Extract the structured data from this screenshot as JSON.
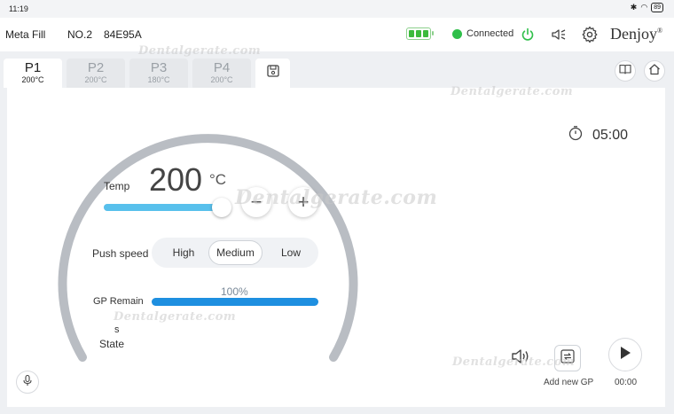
{
  "status_bar": {
    "time": "11:19",
    "battery_level": "89"
  },
  "header": {
    "app_name": "Meta Fill",
    "device_no": "NO.2",
    "device_id": "84E95A",
    "connection_status": "Connected",
    "connection_color": "#2fbf4a",
    "brand": "Denjoy",
    "brand_mark": "®",
    "icons": [
      "battery-icon",
      "power-icon",
      "mute-speaker-icon",
      "settings-gear-icon"
    ]
  },
  "tabs": [
    {
      "name": "P1",
      "temp": "200°C",
      "active": true
    },
    {
      "name": "P2",
      "temp": "200°C",
      "active": false
    },
    {
      "name": "P3",
      "temp": "180°C",
      "active": false
    },
    {
      "name": "P4",
      "temp": "200°C",
      "active": false
    }
  ],
  "tab_actions": {
    "save_icon": "save-icon",
    "manual_icon": "book-icon",
    "home_icon": "home-icon"
  },
  "main": {
    "temp_label": "Temp",
    "temp_value": "200",
    "temp_unit": "°C",
    "temp_slider_fraction": 0.95,
    "minus_label": "−",
    "plus_label": "+",
    "push_speed_label": "Push speed",
    "push_speed_options": [
      "High",
      "Medium",
      "Low"
    ],
    "push_speed_selected": "Medium",
    "gp_remain_label": "GP Remain",
    "gp_remain_pct": "100%",
    "gp_remain_fraction": 1.0,
    "state_unit": "s",
    "state_label": "State",
    "timer_value": "05:00",
    "add_gp_label": "Add new GP",
    "play_time": "00:00",
    "accent_color": "#58c0ec",
    "gp_color": "#1e8fe0"
  },
  "watermark_text": "Dentalgerate.com"
}
